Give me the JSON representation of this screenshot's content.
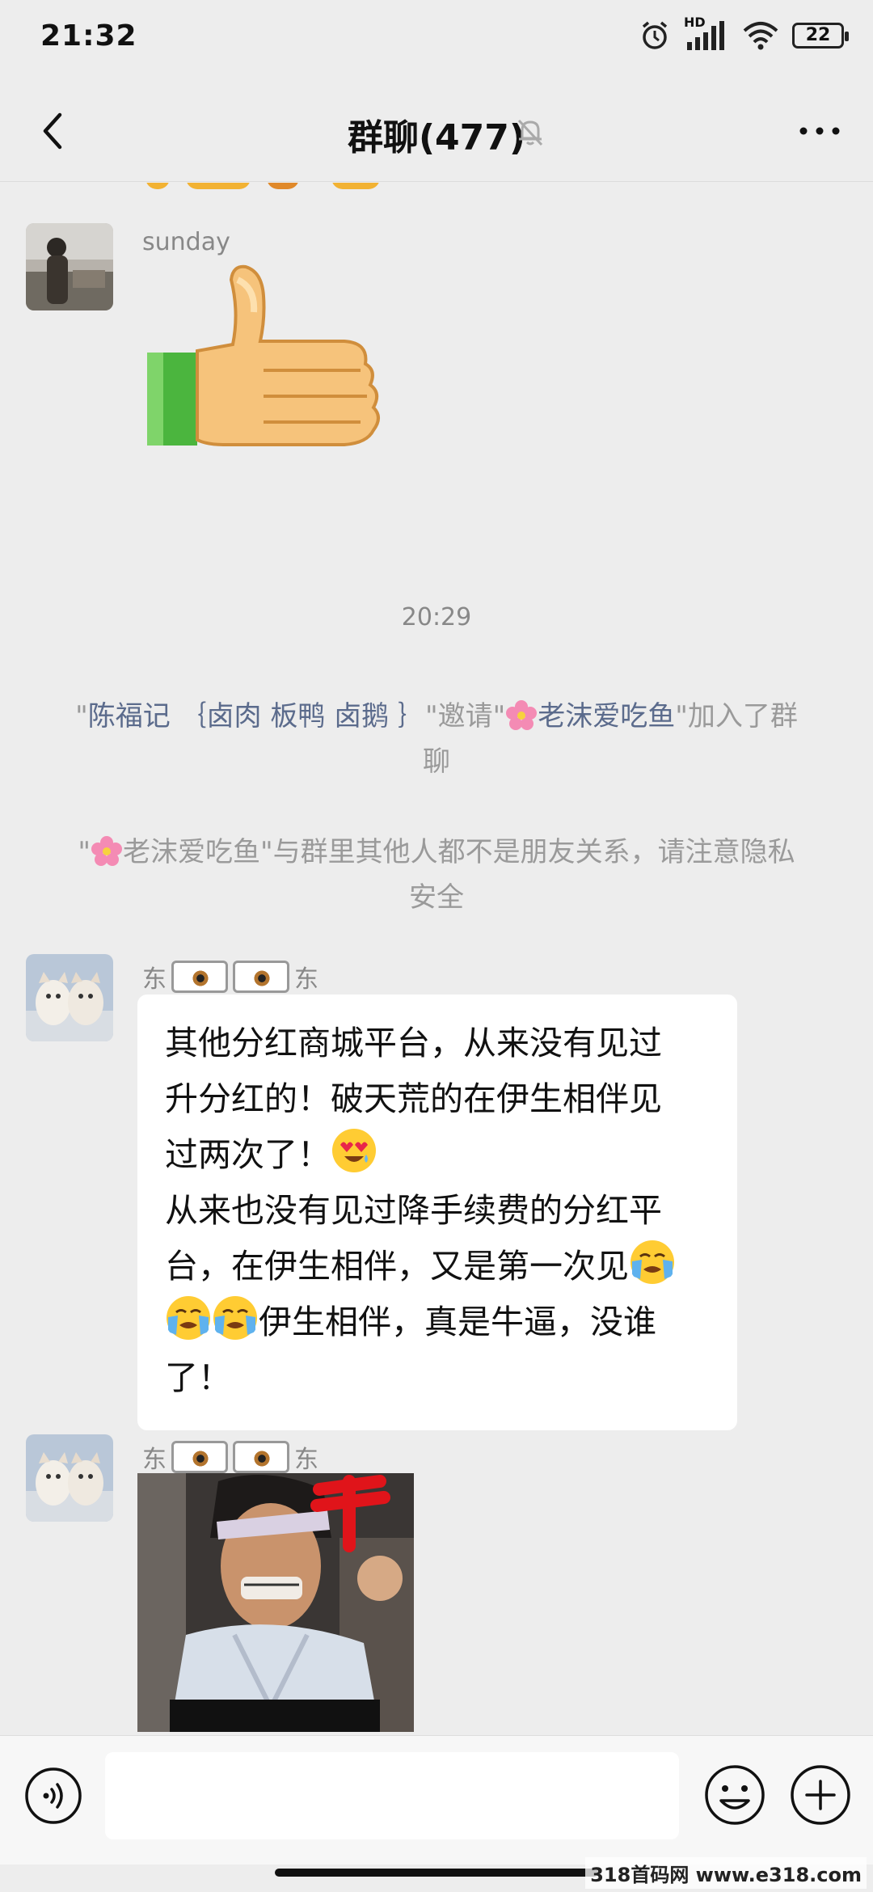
{
  "status_bar": {
    "time": "21:32",
    "network_badge": "HD",
    "battery": "22"
  },
  "header": {
    "title": "群聊(477)"
  },
  "messages": {
    "m1": {
      "sender": "sunday"
    },
    "timestamp": "20:29",
    "system_invite": {
      "q1": "\"",
      "inviter": "陈福记 ｛卤肉 板鸭 卤鹅 ｝",
      "mid": "\"邀请\"",
      "invitee": "老沫爱吃鱼",
      "tail": "\"加入了群聊"
    },
    "system_privacy": {
      "q1": "\"",
      "name": "老沫爱吃鱼",
      "text": "\"与群里其他人都不是朋友关系，请注意隐私安全"
    },
    "m3": {
      "sender_prefix": "东",
      "sender_suffix": "东",
      "lines": [
        "其他分红商城平台，从来没有见过",
        "升分红的！破天荒的在伊生相伴见",
        "过两次了！",
        "从来也没有见过降手续费的分红平",
        "台，在伊生相伴，又是第一次见",
        "伊生相伴，真是牛逼，没谁",
        "了！"
      ]
    },
    "m4": {
      "sender_prefix": "东",
      "sender_suffix": "东"
    }
  },
  "input": {
    "placeholder": ""
  },
  "watermark": "318首码网 www.e318.com",
  "colors": {
    "background": "#ededed",
    "bubble": "#ffffff",
    "link": "#5b6b8c",
    "system_text": "#9a9a9a"
  }
}
